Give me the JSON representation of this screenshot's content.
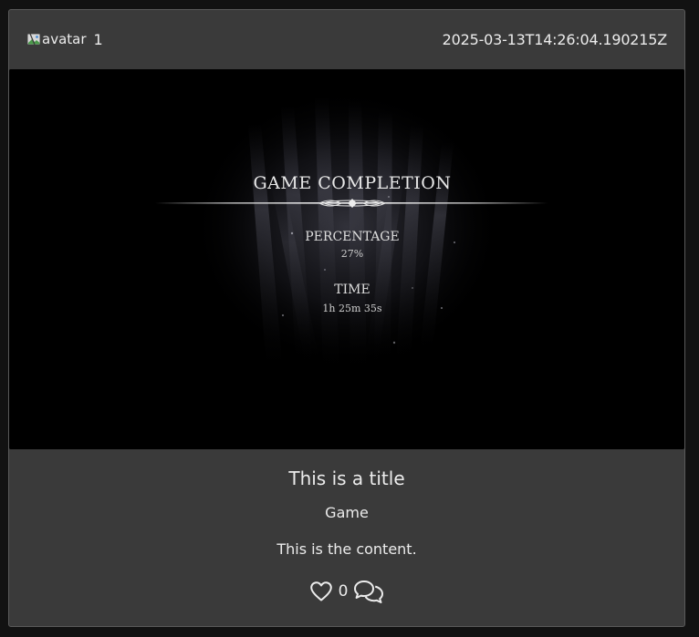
{
  "post": {
    "author": {
      "avatar_alt": "avatar",
      "user_id": "1"
    },
    "timestamp": "2025-03-13T14:26:04.190215Z",
    "image": {
      "heading": "GAME COMPLETION",
      "percentage_label": "PERCENTAGE",
      "percentage_value": "27%",
      "time_label": "TIME",
      "time_value": "1h 25m 35s"
    },
    "title": "This is a title",
    "category": "Game",
    "content": "This is the content.",
    "likes": "0",
    "icons": {
      "like": "heart-icon",
      "comment": "comments-icon",
      "avatar": "broken-image-icon"
    }
  },
  "colors": {
    "page_background": "#121212",
    "card_background": "#3a3a3a",
    "text": "#ececec"
  }
}
